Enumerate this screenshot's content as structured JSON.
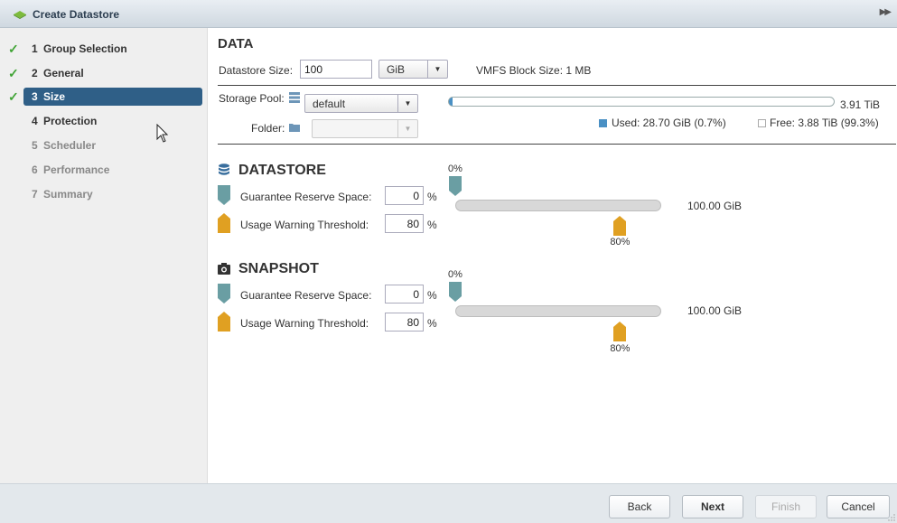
{
  "window": {
    "title": "Create Datastore"
  },
  "steps": [
    {
      "num": "1",
      "label": "Group Selection",
      "state": "done"
    },
    {
      "num": "2",
      "label": "General",
      "state": "done"
    },
    {
      "num": "3",
      "label": "Size",
      "state": "active"
    },
    {
      "num": "4",
      "label": "Protection",
      "state": "pending"
    },
    {
      "num": "5",
      "label": "Scheduler",
      "state": "disabled"
    },
    {
      "num": "6",
      "label": "Performance",
      "state": "disabled"
    },
    {
      "num": "7",
      "label": "Summary",
      "state": "disabled"
    }
  ],
  "data": {
    "heading": "DATA",
    "size_label": "Datastore Size:",
    "size_value": "100",
    "unit": "GiB",
    "block_size": "VMFS Block Size: 1 MB",
    "pool_label": "Storage Pool:",
    "pool_value": "default",
    "folder_label": "Folder:",
    "folder_value": "",
    "pool_total": "3.91 TiB",
    "used_label": "Used: 28.70 GiB (0.7%)",
    "free_label": "Free: 3.88 TiB (99.3%)",
    "used_fraction": 0.007
  },
  "datastore": {
    "title": "DATASTORE",
    "reserve_label": "Guarantee Reserve Space:",
    "reserve_value": "0",
    "warn_label": "Usage Warning Threshold:",
    "warn_value": "80",
    "unit_pct": "%",
    "top_pct": "0%",
    "size": "100.00 GiB",
    "warn_pct": "80%",
    "reserve_fraction": 0.0,
    "warn_fraction": 0.8
  },
  "snapshot": {
    "title": "SNAPSHOT",
    "reserve_label": "Guarantee Reserve Space:",
    "reserve_value": "0",
    "warn_label": "Usage Warning Threshold:",
    "warn_value": "80",
    "unit_pct": "%",
    "top_pct": "0%",
    "size": "100.00 GiB",
    "warn_pct": "80%",
    "reserve_fraction": 0.0,
    "warn_fraction": 0.8
  },
  "footer": {
    "back": "Back",
    "next": "Next",
    "finish": "Finish",
    "cancel": "Cancel"
  },
  "colors": {
    "accent": "#2f5f87",
    "check": "#41a436",
    "reserve_marker": "#6a9ea3",
    "warn_marker": "#e0a022",
    "used": "#4a90c4"
  }
}
